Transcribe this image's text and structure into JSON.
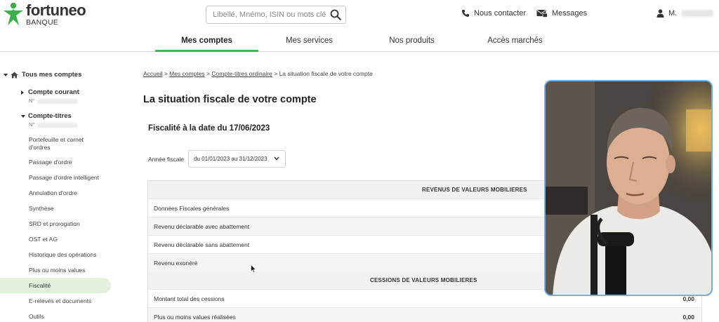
{
  "brand": {
    "name": "fortuneo",
    "sub": "BANQUE"
  },
  "search": {
    "placeholder": "Libellé, Mnémo, ISIN ou mots clés",
    "value": ""
  },
  "header": {
    "contact_label": "Nous contacter",
    "messages_label": "Messages",
    "user_label": "M."
  },
  "nav": {
    "tabs": [
      {
        "label": "Mes comptes",
        "active": true
      },
      {
        "label": "Mes services",
        "active": false
      },
      {
        "label": "Nos produits",
        "active": false
      },
      {
        "label": "Accès marchés",
        "active": false
      }
    ]
  },
  "sidebar": {
    "root_label": "Tous mes comptes",
    "accounts": [
      {
        "label": "Compte courant",
        "number_prefix": "N°"
      },
      {
        "label": "Compte-titres",
        "number_prefix": "N°"
      }
    ],
    "items": [
      "Portefeuille et carnet",
      "d'ordres",
      "Passage d'ordre",
      "Passage d'ordre intelligent",
      "Annulation d'ordre",
      "Synthèse",
      "SRD et prorogation",
      "OST et AG",
      "Historique des opérations",
      "Plus ou moins values",
      "Fiscalité",
      "E-relevés et documents",
      "Outils"
    ],
    "active_item": "Fiscalité"
  },
  "breadcrumb": {
    "items": [
      "Accueil",
      "Mes comptes",
      "Compte-titres ordinaire",
      "La situation fiscale de votre compte"
    ],
    "separator": ">"
  },
  "page": {
    "title": "La situation fiscale de votre compte",
    "subtitle": "Fiscalité à la date du 17/06/2023",
    "year_label": "Année fiscale",
    "year_value": "du 01/01/2023 au 31/12/2023"
  },
  "table": {
    "section1_title": "REVENUS DE VALEURS MOBILIERES",
    "section1_rows": [
      {
        "label": "Données Fiscales générales",
        "value": ""
      },
      {
        "label": "Revenu déclarable avec abattement",
        "value": ""
      },
      {
        "label": "Revenu déclarable sans abattement",
        "value": ""
      },
      {
        "label": "Revenu exonéré",
        "value": ""
      }
    ],
    "section2_title": "CESSIONS DE VALEURS MOBILIERES",
    "section2_rows": [
      {
        "label": "Montant total des cessions",
        "value": "0,00"
      },
      {
        "label": "Plus ou moins values réalisées",
        "value": "0,00"
      }
    ]
  },
  "colors": {
    "brand_green": "#4caf50",
    "active_item_bg": "#e4efdc",
    "webcam_border": "#6fb0e0"
  }
}
